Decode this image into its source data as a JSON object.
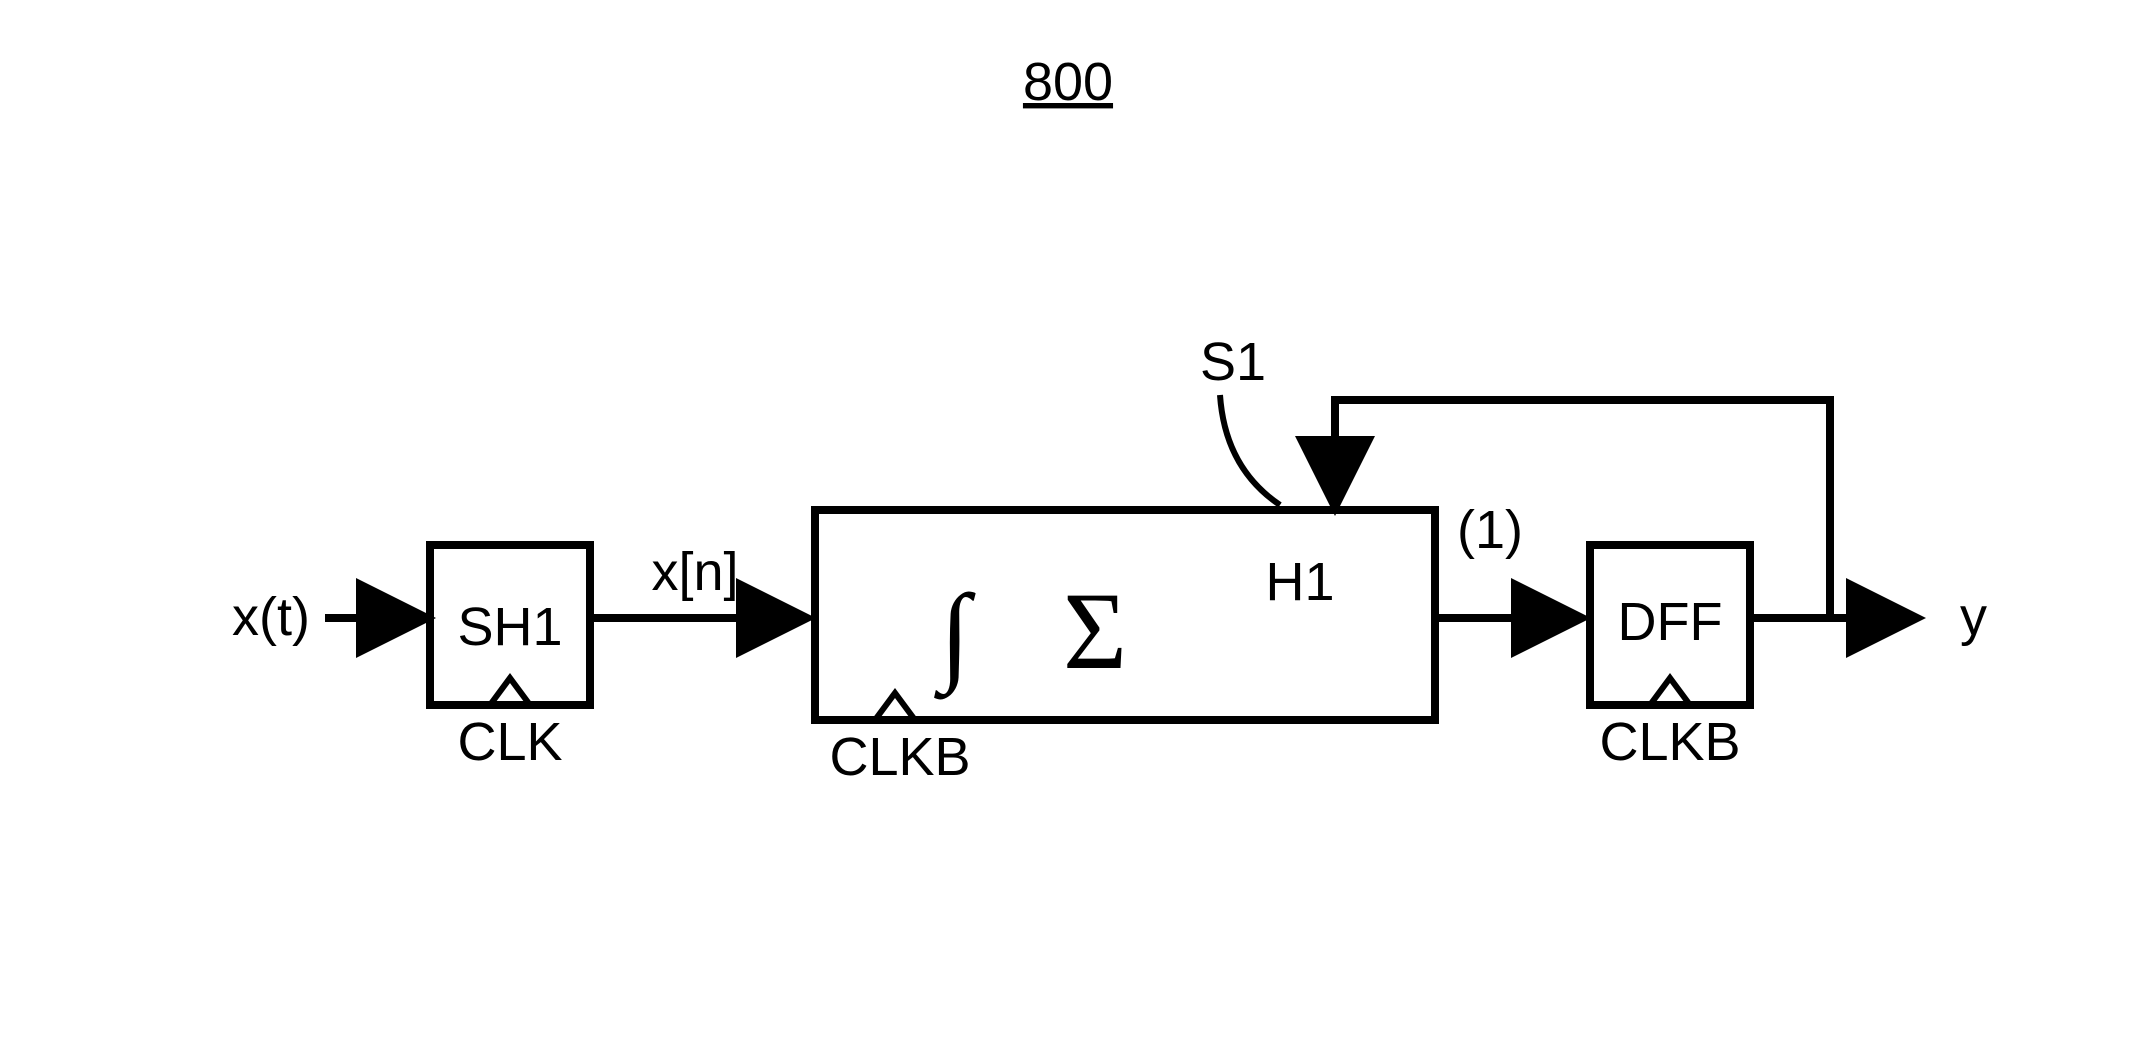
{
  "figure_number": "800",
  "input_signal": "x(t)",
  "sampled_signal": "x[n]",
  "output_signal": "y",
  "output_bit_width": "(1)",
  "feedback_label": "S1",
  "blocks": {
    "sample_hold": {
      "label": "SH1",
      "clock": "CLK"
    },
    "sigma_delta": {
      "label": "H1",
      "clock": "CLKB",
      "integral_symbol": "∫",
      "sigma_symbol": "Σ"
    },
    "dff": {
      "label": "DFF",
      "clock": "CLKB"
    }
  }
}
